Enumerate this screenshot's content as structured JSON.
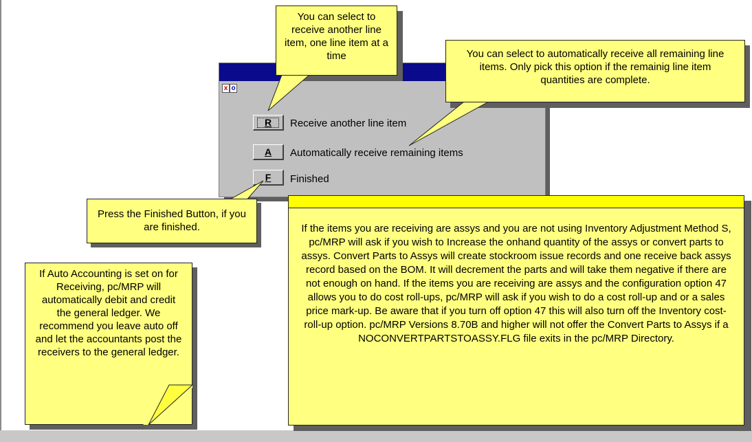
{
  "dialog": {
    "close_glyph": "x",
    "restore_glyph": "o",
    "buttons": [
      {
        "key": "R",
        "label": "Receive another line item"
      },
      {
        "key": "A",
        "label": "Automatically receive remaining items"
      },
      {
        "key": "F",
        "label": "Finished"
      }
    ]
  },
  "callouts": {
    "receive_another": "You can select to receive another line item, one line item at a time",
    "auto_receive": "You can select to automatically receive all remaining line items.  Only pick this option if the remainig line item quantities are complete.",
    "finished": "Press the Finished Button, if you are finished.",
    "auto_accounting": "If Auto Accounting is set on for Receiving, pc/MRP will automatically debit and credit the general ledger.  We recommend you leave auto off and let the accountants post the receivers to the general ledger.",
    "assys_info": "If the items you are receiving are assys and you are not using Inventory Adjustment Method S, pc/MRP will ask if you wish to Increase the onhand quantity of the assys or convert parts to assys. Convert Parts to Assys will create stockroom issue records and one receive back assys record based on the BOM.  It will decrement the parts and will take them negative if there are not enough on hand.   If the items you are receiving are assys and the configuration option 47 allows you to do cost roll-ups, pc/MRP will ask if you wish to do a cost roll-up and or a sales price mark-up. Be aware that if you turn off option 47 this will also turn off the Inventory cost-roll-up option.  pc/MRP Versions 8.70B and higher will not offer the Convert Parts to Assys if a NOCONVERTPARTSTOASSY.FLG file exits in the pc/MRP Directory."
  },
  "colors": {
    "note_fill": "#ffff80",
    "banner_fill": "#ffff00",
    "titlebar": "#0a0a8c",
    "dialog_bg": "#c0c0c0"
  }
}
